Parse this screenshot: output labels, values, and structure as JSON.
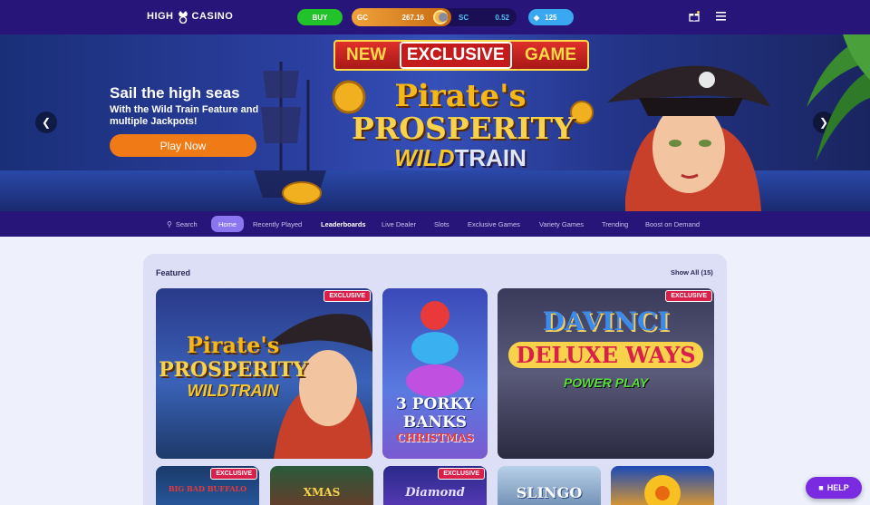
{
  "header": {
    "logo_text_left": "HIGH",
    "logo_text_right": "CASINO",
    "buy_label": "BUY",
    "gc_label": "GC",
    "gc_value": "267.16",
    "sc_label": "SC",
    "sc_value": "0.52",
    "gems_value": "125"
  },
  "hero": {
    "title": "Sail the high seas",
    "subtitle": "With the Wild Train Feature and multiple Jackpots!",
    "play_label": "Play Now",
    "banner_new": "NEW",
    "banner_exclusive": "EXCLUSIVE",
    "banner_game": "GAME",
    "game_line1": "Pirate's",
    "game_line2": "PROSPERITY",
    "game_line3a": "WILD",
    "game_line3b": "TRAIN"
  },
  "nav": {
    "search": "Search",
    "home": "Home",
    "recently_played": "Recently Played",
    "leaderboards": "Leaderboards",
    "live_dealer": "Live Dealer",
    "slots": "Slots",
    "exclusive_games": "Exclusive Games",
    "variety_games": "Variety Games",
    "trending": "Trending",
    "boost": "Boost on Demand"
  },
  "featured": {
    "title": "Featured",
    "show_all": "Show All (15)",
    "exclusive_badge": "EXCLUSIVE",
    "cards": [
      {
        "line1": "Pirate's",
        "line2": "PROSPERITY",
        "line3": "WILDTRAIN"
      },
      {
        "line1": "3 PORKY",
        "line2": "BANKS",
        "line3": "CHRISTMAS"
      },
      {
        "line1": "DAVINCI",
        "line2": "DELUXE WAYS",
        "line3": "POWER PLAY"
      },
      {
        "line1": "BIG BAD BUFFALO"
      },
      {
        "line1": "XMAS"
      },
      {
        "line1": "Diamond"
      },
      {
        "line1": "SLINGO"
      },
      {
        "line1": ""
      }
    ]
  },
  "help_label": "HELP"
}
